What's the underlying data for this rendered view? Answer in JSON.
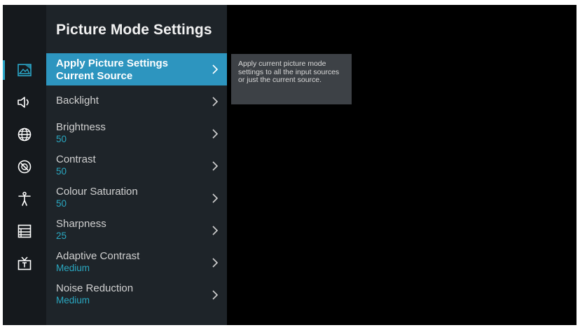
{
  "panel": {
    "title": "Picture Mode Settings",
    "items": [
      {
        "label": "Apply Picture Settings",
        "value": "Current Source"
      },
      {
        "label": "Backlight",
        "value": ""
      },
      {
        "label": "Brightness",
        "value": "50"
      },
      {
        "label": "Contrast",
        "value": "50"
      },
      {
        "label": "Colour Saturation",
        "value": "50"
      },
      {
        "label": "Sharpness",
        "value": "25"
      },
      {
        "label": "Adaptive Contrast",
        "value": "Medium"
      },
      {
        "label": "Noise Reduction",
        "value": "Medium"
      }
    ]
  },
  "tooltip": {
    "text": "Apply current picture mode settings to all the input sources or just the current source."
  },
  "nav": {
    "items": [
      {
        "icon": "picture-icon",
        "active": true
      },
      {
        "icon": "sound-icon",
        "active": false
      },
      {
        "icon": "globe-icon",
        "active": false
      },
      {
        "icon": "dial-icon",
        "active": false
      },
      {
        "icon": "accessibility-icon",
        "active": false
      },
      {
        "icon": "list-icon",
        "active": false
      },
      {
        "icon": "tv-icon",
        "active": false
      }
    ]
  },
  "colors": {
    "accent": "#2d95bf",
    "value_text": "#2aa7c0",
    "panel_bg": "#1e2429",
    "nav_bg": "#15191d"
  }
}
